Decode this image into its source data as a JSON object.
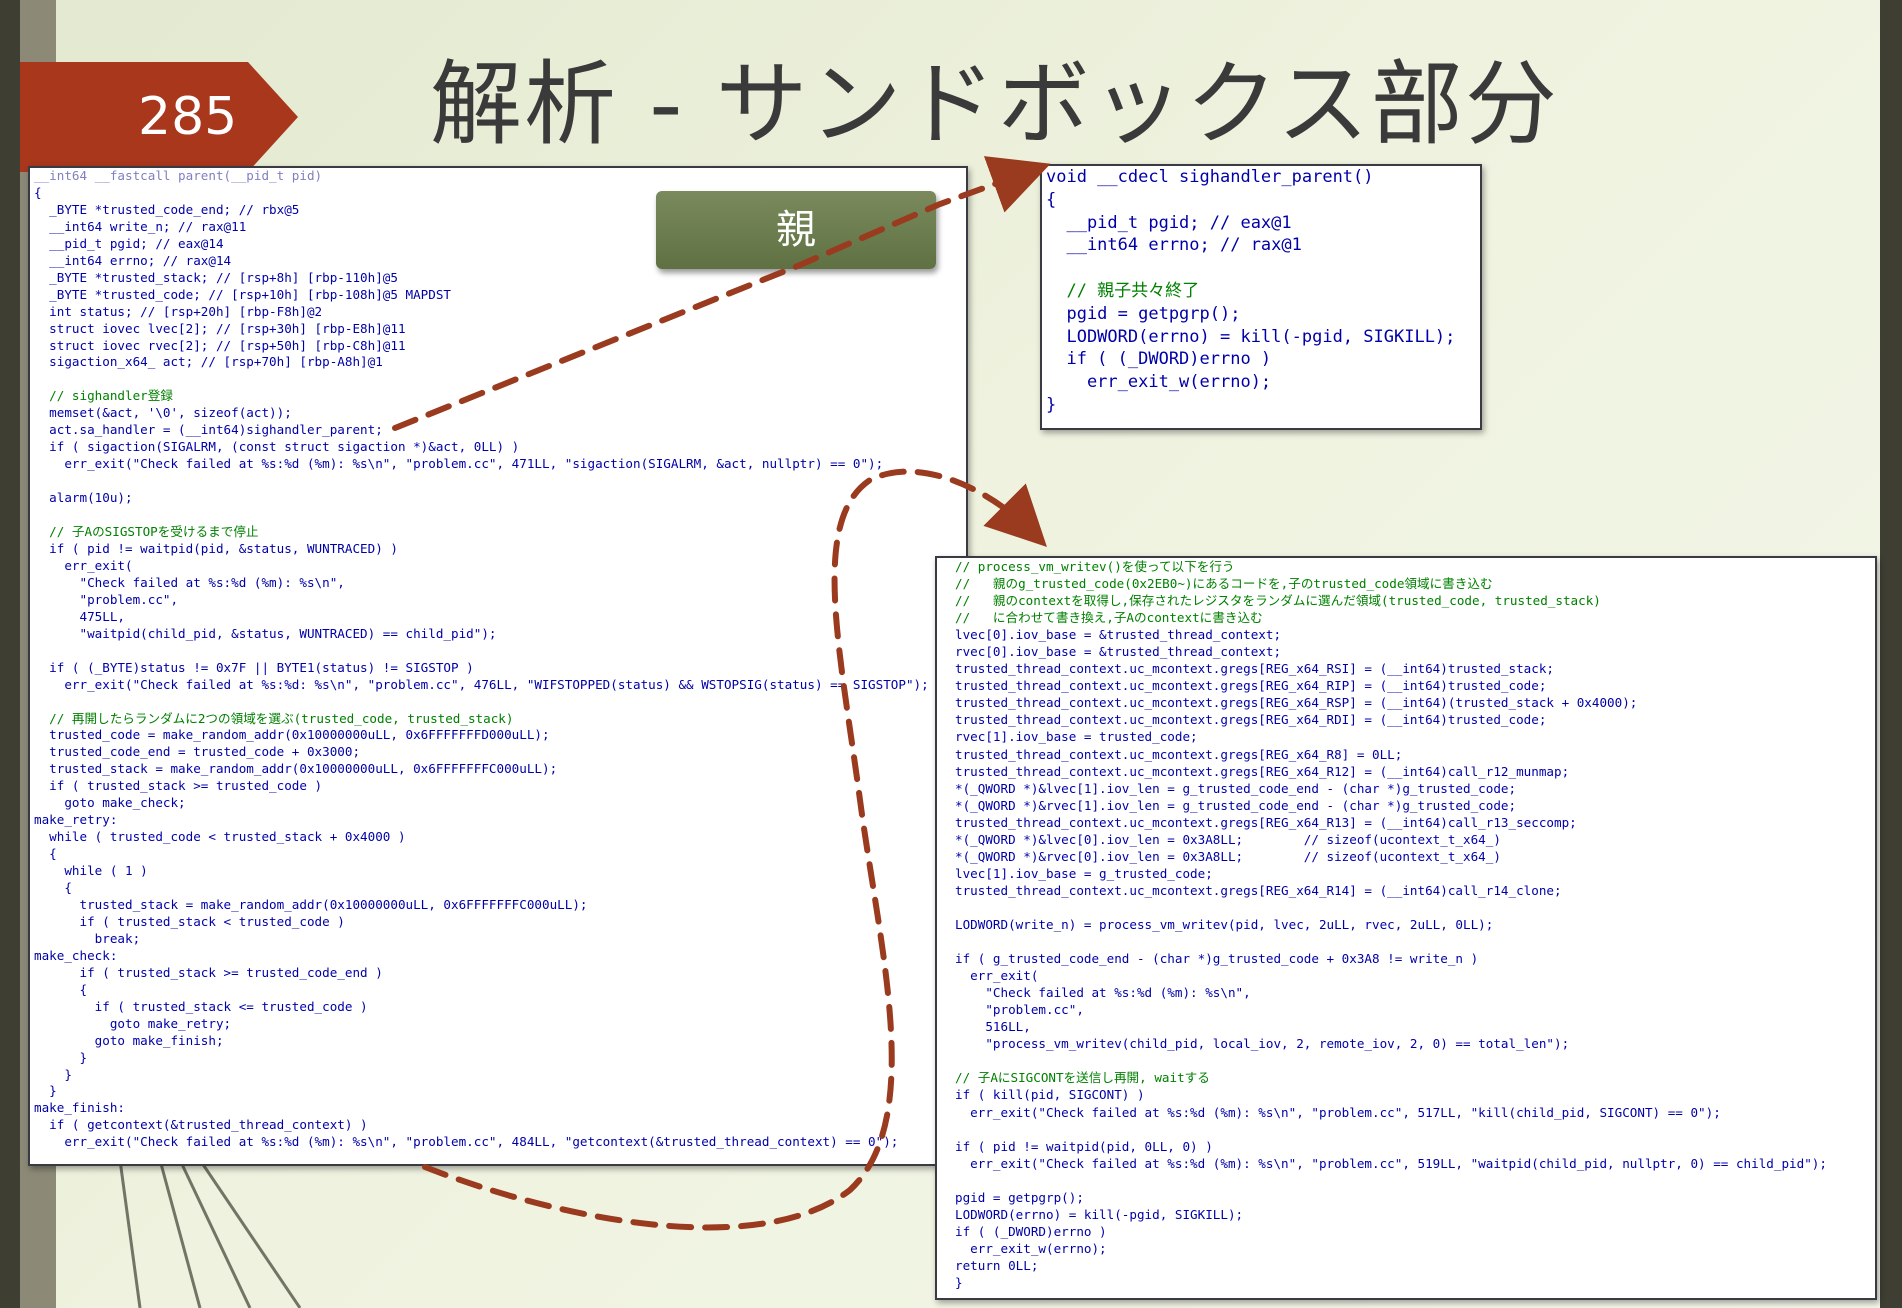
{
  "slide": {
    "number": "285",
    "title": "解析 - サンドボックス部分",
    "label": "親"
  },
  "colors": {
    "accent": "#a8371c",
    "label": "#66784a",
    "code": "#0000a8",
    "comment": "#008000"
  },
  "code_left": [
    {
      "text": "__int64 __fastcall parent(__pid_t pid)",
      "style": "v"
    },
    {
      "text": "{",
      "style": ""
    },
    {
      "text": "  _BYTE *trusted_code_end; // rbx@5",
      "style": ""
    },
    {
      "text": "  __int64 write_n; // rax@11",
      "style": ""
    },
    {
      "text": "  __pid_t pgid; // eax@14",
      "style": ""
    },
    {
      "text": "  __int64 errno; // rax@14",
      "style": ""
    },
    {
      "text": "  _BYTE *trusted_stack; // [rsp+8h] [rbp-110h]@5",
      "style": ""
    },
    {
      "text": "  _BYTE *trusted_code; // [rsp+10h] [rbp-108h]@5 MAPDST",
      "style": ""
    },
    {
      "text": "  int status; // [rsp+20h] [rbp-F8h]@2",
      "style": ""
    },
    {
      "text": "  struct iovec lvec[2]; // [rsp+30h] [rbp-E8h]@11",
      "style": ""
    },
    {
      "text": "  struct iovec rvec[2]; // [rsp+50h] [rbp-C8h]@11",
      "style": ""
    },
    {
      "text": "  sigaction_x64_ act; // [rsp+70h] [rbp-A8h]@1",
      "style": ""
    },
    {
      "text": "",
      "style": ""
    },
    {
      "text": "  // sighandler登録",
      "style": "c"
    },
    {
      "text": "  memset(&act, '\\0', sizeof(act));",
      "style": ""
    },
    {
      "text": "  act.sa_handler = (__int64)sighandler_parent;",
      "style": ""
    },
    {
      "text": "  if ( sigaction(SIGALRM, (const struct sigaction *)&act, 0LL) )",
      "style": ""
    },
    {
      "text": "    err_exit(\"Check failed at %s:%d (%m): %s\\n\", \"problem.cc\", 471LL, \"sigaction(SIGALRM, &act, nullptr) == 0\");",
      "style": ""
    },
    {
      "text": "",
      "style": ""
    },
    {
      "text": "  alarm(10u);",
      "style": ""
    },
    {
      "text": "",
      "style": ""
    },
    {
      "text": "  // 子AのSIGSTOPを受けるまで停止",
      "style": "c"
    },
    {
      "text": "  if ( pid != waitpid(pid, &status, WUNTRACED) )",
      "style": ""
    },
    {
      "text": "    err_exit(",
      "style": ""
    },
    {
      "text": "      \"Check failed at %s:%d (%m): %s\\n\",",
      "style": ""
    },
    {
      "text": "      \"problem.cc\",",
      "style": ""
    },
    {
      "text": "      475LL,",
      "style": ""
    },
    {
      "text": "      \"waitpid(child_pid, &status, WUNTRACED) == child_pid\");",
      "style": ""
    },
    {
      "text": "",
      "style": ""
    },
    {
      "text": "  if ( (_BYTE)status != 0x7F || BYTE1(status) != SIGSTOP )",
      "style": ""
    },
    {
      "text": "    err_exit(\"Check failed at %s:%d: %s\\n\", \"problem.cc\", 476LL, \"WIFSTOPPED(status) && WSTOPSIG(status) == SIGSTOP\");",
      "style": ""
    },
    {
      "text": "",
      "style": ""
    },
    {
      "text": "  // 再開したらランダムに2つの領域を選ぶ(trusted_code, trusted_stack)",
      "style": "c"
    },
    {
      "text": "  trusted_code = make_random_addr(0x10000000uLL, 0x6FFFFFFFD000uLL);",
      "style": ""
    },
    {
      "text": "  trusted_code_end = trusted_code + 0x3000;",
      "style": ""
    },
    {
      "text": "  trusted_stack = make_random_addr(0x10000000uLL, 0x6FFFFFFFC000uLL);",
      "style": ""
    },
    {
      "text": "  if ( trusted_stack >= trusted_code )",
      "style": ""
    },
    {
      "text": "    goto make_check;",
      "style": ""
    },
    {
      "text": "make_retry:",
      "style": ""
    },
    {
      "text": "  while ( trusted_code < trusted_stack + 0x4000 )",
      "style": ""
    },
    {
      "text": "  {",
      "style": ""
    },
    {
      "text": "    while ( 1 )",
      "style": ""
    },
    {
      "text": "    {",
      "style": ""
    },
    {
      "text": "      trusted_stack = make_random_addr(0x10000000uLL, 0x6FFFFFFFC000uLL);",
      "style": ""
    },
    {
      "text": "      if ( trusted_stack < trusted_code )",
      "style": ""
    },
    {
      "text": "        break;",
      "style": ""
    },
    {
      "text": "make_check:",
      "style": ""
    },
    {
      "text": "      if ( trusted_stack >= trusted_code_end )",
      "style": ""
    },
    {
      "text": "      {",
      "style": ""
    },
    {
      "text": "        if ( trusted_stack <= trusted_code )",
      "style": ""
    },
    {
      "text": "          goto make_retry;",
      "style": ""
    },
    {
      "text": "        goto make_finish;",
      "style": ""
    },
    {
      "text": "      }",
      "style": ""
    },
    {
      "text": "    }",
      "style": ""
    },
    {
      "text": "  }",
      "style": ""
    },
    {
      "text": "make_finish:",
      "style": ""
    },
    {
      "text": "  if ( getcontext(&trusted_thread_context) )",
      "style": ""
    },
    {
      "text": "    err_exit(\"Check failed at %s:%d (%m): %s\\n\", \"problem.cc\", 484LL, \"getcontext(&trusted_thread_context) == 0\");",
      "style": ""
    }
  ],
  "code_top_right": [
    {
      "text": "void __cdecl sighandler_parent()",
      "style": ""
    },
    {
      "text": "{",
      "style": ""
    },
    {
      "text": "  __pid_t pgid; // eax@1",
      "style": ""
    },
    {
      "text": "  __int64 errno; // rax@1",
      "style": ""
    },
    {
      "text": "",
      "style": ""
    },
    {
      "text": "  // 親子共々終了",
      "style": "c"
    },
    {
      "text": "  pgid = getpgrp();",
      "style": ""
    },
    {
      "text": "  LODWORD(errno) = kill(-pgid, SIGKILL);",
      "style": ""
    },
    {
      "text": "  if ( (_DWORD)errno )",
      "style": ""
    },
    {
      "text": "    err_exit_w(errno);",
      "style": ""
    },
    {
      "text": "}",
      "style": ""
    }
  ],
  "code_bottom_right": [
    {
      "text": "// process_vm_writev()を使って以下を行う",
      "style": "c"
    },
    {
      "text": "//   親のg_trusted_code(0x2EB0~)にあるコードを,子のtrusted_code領域に書き込む",
      "style": "c"
    },
    {
      "text": "//   親のcontextを取得し,保存されたレジスタをランダムに選んだ領域(trusted_code, trusted_stack)",
      "style": "c"
    },
    {
      "text": "//   に合わせて書き換え,子Aのcontextに書き込む",
      "style": "c"
    },
    {
      "text": "lvec[0].iov_base = &trusted_thread_context;",
      "style": ""
    },
    {
      "text": "rvec[0].iov_base = &trusted_thread_context;",
      "style": ""
    },
    {
      "text": "trusted_thread_context.uc_mcontext.gregs[REG_x64_RSI] = (__int64)trusted_stack;",
      "style": ""
    },
    {
      "text": "trusted_thread_context.uc_mcontext.gregs[REG_x64_RIP] = (__int64)trusted_code;",
      "style": ""
    },
    {
      "text": "trusted_thread_context.uc_mcontext.gregs[REG_x64_RSP] = (__int64)(trusted_stack + 0x4000);",
      "style": ""
    },
    {
      "text": "trusted_thread_context.uc_mcontext.gregs[REG_x64_RDI] = (__int64)trusted_code;",
      "style": ""
    },
    {
      "text": "rvec[1].iov_base = trusted_code;",
      "style": ""
    },
    {
      "text": "trusted_thread_context.uc_mcontext.gregs[REG_x64_R8] = 0LL;",
      "style": ""
    },
    {
      "text": "trusted_thread_context.uc_mcontext.gregs[REG_x64_R12] = (__int64)call_r12_munmap;",
      "style": ""
    },
    {
      "text": "*(_QWORD *)&lvec[1].iov_len = g_trusted_code_end - (char *)g_trusted_code;",
      "style": ""
    },
    {
      "text": "*(_QWORD *)&rvec[1].iov_len = g_trusted_code_end - (char *)g_trusted_code;",
      "style": ""
    },
    {
      "text": "trusted_thread_context.uc_mcontext.gregs[REG_x64_R13] = (__int64)call_r13_seccomp;",
      "style": ""
    },
    {
      "text": "*(_QWORD *)&lvec[0].iov_len = 0x3A8LL;        // sizeof(ucontext_t_x64_)",
      "style": ""
    },
    {
      "text": "*(_QWORD *)&rvec[0].iov_len = 0x3A8LL;        // sizeof(ucontext_t_x64_)",
      "style": ""
    },
    {
      "text": "lvec[1].iov_base = g_trusted_code;",
      "style": ""
    },
    {
      "text": "trusted_thread_context.uc_mcontext.gregs[REG_x64_R14] = (__int64)call_r14_clone;",
      "style": ""
    },
    {
      "text": "",
      "style": ""
    },
    {
      "text": "LODWORD(write_n) = process_vm_writev(pid, lvec, 2uLL, rvec, 2uLL, 0LL);",
      "style": ""
    },
    {
      "text": "",
      "style": ""
    },
    {
      "text": "if ( g_trusted_code_end - (char *)g_trusted_code + 0x3A8 != write_n )",
      "style": ""
    },
    {
      "text": "  err_exit(",
      "style": ""
    },
    {
      "text": "    \"Check failed at %s:%d (%m): %s\\n\",",
      "style": ""
    },
    {
      "text": "    \"problem.cc\",",
      "style": ""
    },
    {
      "text": "    516LL,",
      "style": ""
    },
    {
      "text": "    \"process_vm_writev(child_pid, local_iov, 2, remote_iov, 2, 0) == total_len\");",
      "style": ""
    },
    {
      "text": "",
      "style": ""
    },
    {
      "text": "// 子AにSIGCONTを送信し再開, waitする",
      "style": "c"
    },
    {
      "text": "if ( kill(pid, SIGCONT) )",
      "style": ""
    },
    {
      "text": "  err_exit(\"Check failed at %s:%d (%m): %s\\n\", \"problem.cc\", 517LL, \"kill(child_pid, SIGCONT) == 0\");",
      "style": ""
    },
    {
      "text": "",
      "style": ""
    },
    {
      "text": "if ( pid != waitpid(pid, 0LL, 0) )",
      "style": ""
    },
    {
      "text": "  err_exit(\"Check failed at %s:%d (%m): %s\\n\", \"problem.cc\", 519LL, \"waitpid(child_pid, nullptr, 0) == child_pid\");",
      "style": ""
    },
    {
      "text": "",
      "style": ""
    },
    {
      "text": "pgid = getpgrp();",
      "style": ""
    },
    {
      "text": "LODWORD(errno) = kill(-pgid, SIGKILL);",
      "style": ""
    },
    {
      "text": "if ( (_DWORD)errno )",
      "style": ""
    },
    {
      "text": "  err_exit_w(errno);",
      "style": ""
    },
    {
      "text": "return 0LL;",
      "style": ""
    },
    {
      "text": "}",
      "style": ""
    }
  ]
}
